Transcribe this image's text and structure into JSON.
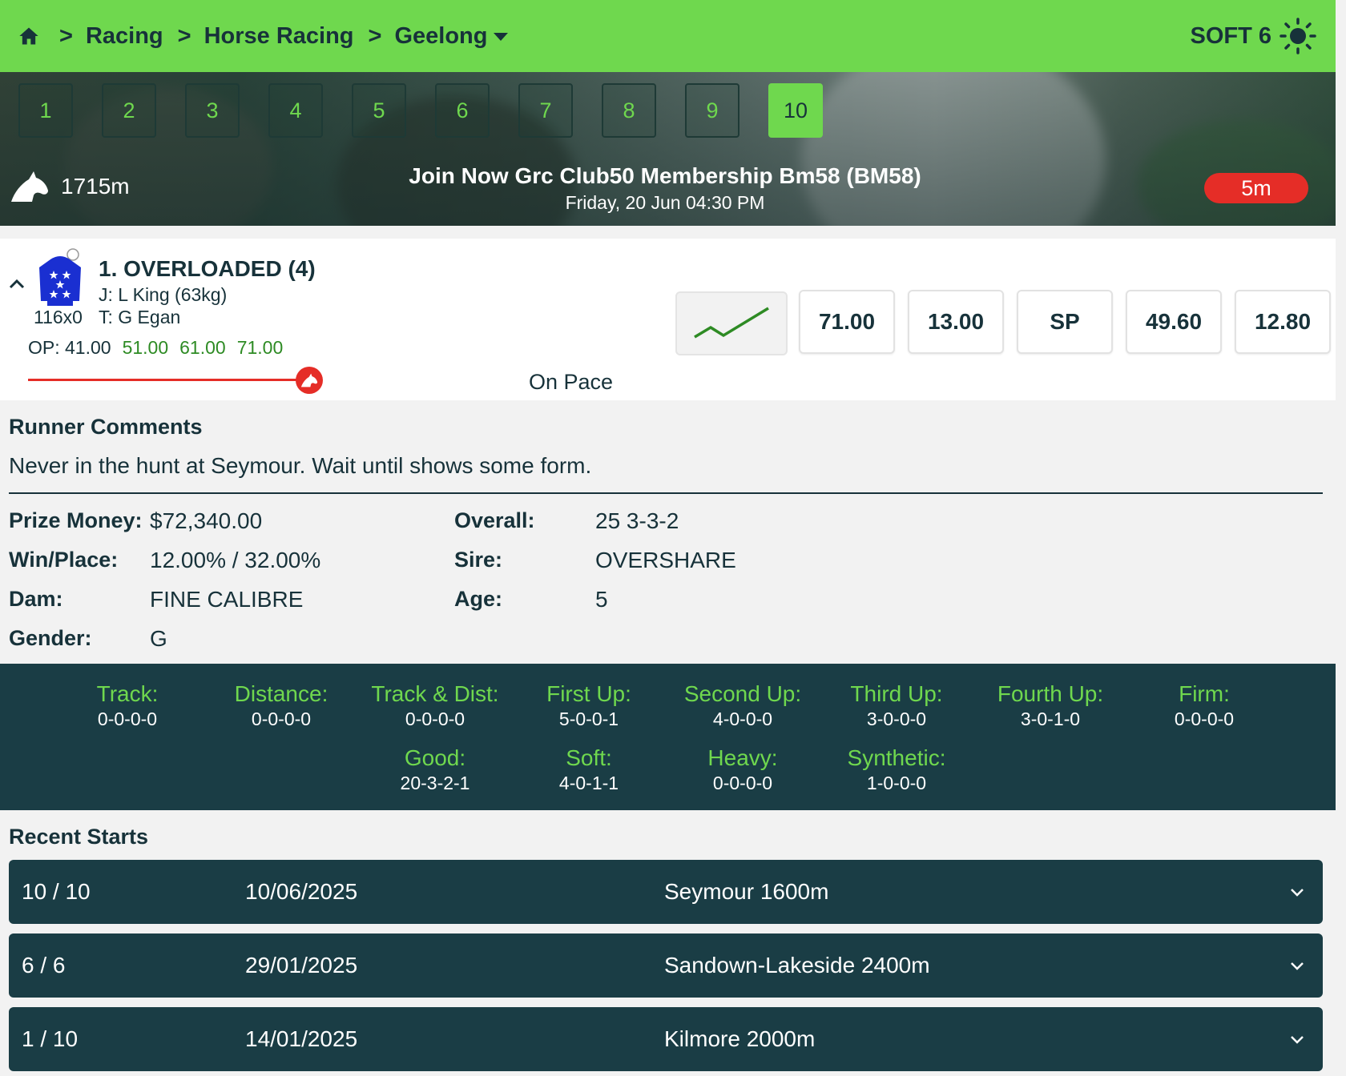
{
  "header": {
    "breadcrumbs": [
      "Racing",
      "Horse Racing",
      "Geelong"
    ],
    "separator": ">",
    "track_condition": "SOFT 6"
  },
  "race_tabs": [
    "1",
    "2",
    "3",
    "4",
    "5",
    "6",
    "7",
    "8",
    "9",
    "10"
  ],
  "active_race": "10",
  "race": {
    "distance": "1715m",
    "title": "Join Now Grc Club50 Membership Bm58 (BM58)",
    "datetime": "Friday, 20 Jun 04:30 PM",
    "countdown": "5m"
  },
  "runner": {
    "name": "1. OVERLOADED (4)",
    "jockey": "J: L King (63kg)",
    "trainer": "T: G Egan",
    "form": "116x0",
    "open_price": "OP: 41.00",
    "price_moves": [
      "51.00",
      "61.00",
      "71.00"
    ],
    "pace": "On Pace",
    "odds": [
      "71.00",
      "13.00",
      "SP",
      "49.60",
      "12.80"
    ]
  },
  "comments": {
    "title": "Runner Comments",
    "text": "Never in the hunt at Seymour. Wait until shows some form."
  },
  "details": {
    "prize_money_label": "Prize Money:",
    "prize_money": "$72,340.00",
    "win_place_label": "Win/Place:",
    "win_place": "12.00% / 32.00%",
    "dam_label": "Dam:",
    "dam": "FINE CALIBRE",
    "gender_label": "Gender:",
    "gender": "G",
    "overall_label": "Overall:",
    "overall": "25 3-3-2",
    "sire_label": "Sire:",
    "sire": "OVERSHARE",
    "age_label": "Age:",
    "age": "5"
  },
  "stats": [
    {
      "label": "Track:",
      "value": "0-0-0-0"
    },
    {
      "label": "Distance:",
      "value": "0-0-0-0"
    },
    {
      "label": "Track & Dist:",
      "value": "0-0-0-0"
    },
    {
      "label": "First Up:",
      "value": "5-0-0-1"
    },
    {
      "label": "Second Up:",
      "value": "4-0-0-0"
    },
    {
      "label": "Third Up:",
      "value": "3-0-0-0"
    },
    {
      "label": "Fourth Up:",
      "value": "3-0-1-0"
    },
    {
      "label": "Firm:",
      "value": "0-0-0-0"
    },
    {
      "label": "Good:",
      "value": "20-3-2-1"
    },
    {
      "label": "Soft:",
      "value": "4-0-1-1"
    },
    {
      "label": "Heavy:",
      "value": "0-0-0-0"
    },
    {
      "label": "Synthetic:",
      "value": "1-0-0-0"
    }
  ],
  "recent_starts": {
    "title": "Recent Starts",
    "rows": [
      {
        "position": "10 / 10",
        "date": "10/06/2025",
        "venue": "Seymour 1600m"
      },
      {
        "position": "6 / 6",
        "date": "29/01/2025",
        "venue": "Sandown-Lakeside 2400m"
      },
      {
        "position": "1 / 10",
        "date": "14/01/2025",
        "venue": "Kilmore 2000m"
      }
    ]
  },
  "colors": {
    "brand_green": "#6fd84e",
    "dark_teal": "#1a3d45",
    "alert_red": "#e52d27",
    "text_dark": "#17323a",
    "price_up_green": "#2e8b24"
  },
  "icons": [
    "home-icon",
    "caret-down-icon",
    "sun-icon",
    "horse-head-icon",
    "chevron-up-icon",
    "jockey-silk-icon",
    "trend-line-icon",
    "chevron-down-icon"
  ]
}
